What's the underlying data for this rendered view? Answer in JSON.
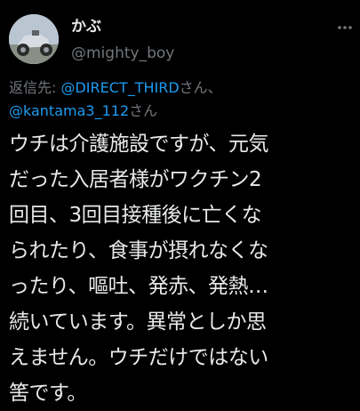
{
  "author": {
    "display_name": "かぶ",
    "handle": "@mighty_boy"
  },
  "reply": {
    "prefix": "返信先: ",
    "mentions": [
      "@DIRECT_THIRD",
      "@kantama3_112"
    ],
    "suffix1": "さん、",
    "suffix2": "さん"
  },
  "tweet": {
    "lines": [
      "ウチは介護施設ですが、元気",
      "だった入居者様がワクチン2",
      "回目、3回目接種後に亡くな",
      "られたり、食事が摂れなくな",
      "ったり、嘔吐、発赤、発熱…",
      "続いています。異常としか思",
      "えません。ウチだけではない",
      "筈です。"
    ]
  },
  "icons": {
    "more": "more-options-icon"
  },
  "colors": {
    "background": "#000000",
    "text": "#e7e9ea",
    "muted": "#71767b",
    "link": "#1d9bf0"
  }
}
